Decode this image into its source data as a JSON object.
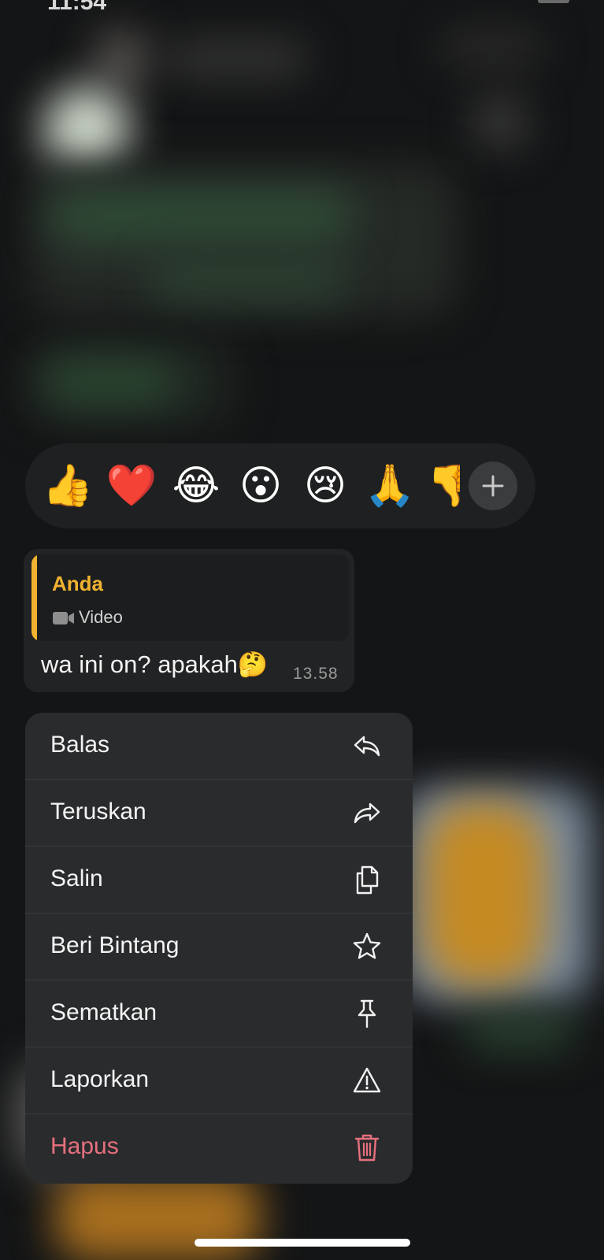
{
  "status_bar": {
    "time": "11:54"
  },
  "reactions": {
    "emojis": [
      {
        "name": "thumbs-up",
        "glyph": "👍"
      },
      {
        "name": "heart",
        "glyph": "❤️"
      },
      {
        "name": "tears-of-joy",
        "glyph": "😂"
      },
      {
        "name": "surprised",
        "glyph": "😮"
      },
      {
        "name": "crying",
        "glyph": "😢"
      },
      {
        "name": "pray",
        "glyph": "🙏"
      },
      {
        "name": "thumbs-down",
        "glyph": "👎"
      }
    ],
    "more_icon": "plus-icon"
  },
  "message": {
    "quote_sender": "Anda",
    "quote_type": "Video",
    "quote_icon": "video-camera-icon",
    "text": "wa ini on? apakah🤔",
    "time": "13.58",
    "accent_color": "#f0b230"
  },
  "menu": {
    "items": [
      {
        "label": "Balas",
        "icon": "reply-icon"
      },
      {
        "label": "Teruskan",
        "icon": "forward-icon"
      },
      {
        "label": "Salin",
        "icon": "copy-icon"
      },
      {
        "label": "Beri Bintang",
        "icon": "star-icon"
      },
      {
        "label": "Sematkan",
        "icon": "pin-icon"
      },
      {
        "label": "Laporkan",
        "icon": "warning-icon"
      },
      {
        "label": "Hapus",
        "icon": "trash-icon",
        "danger": true
      }
    ],
    "danger_color": "#e7707e"
  }
}
